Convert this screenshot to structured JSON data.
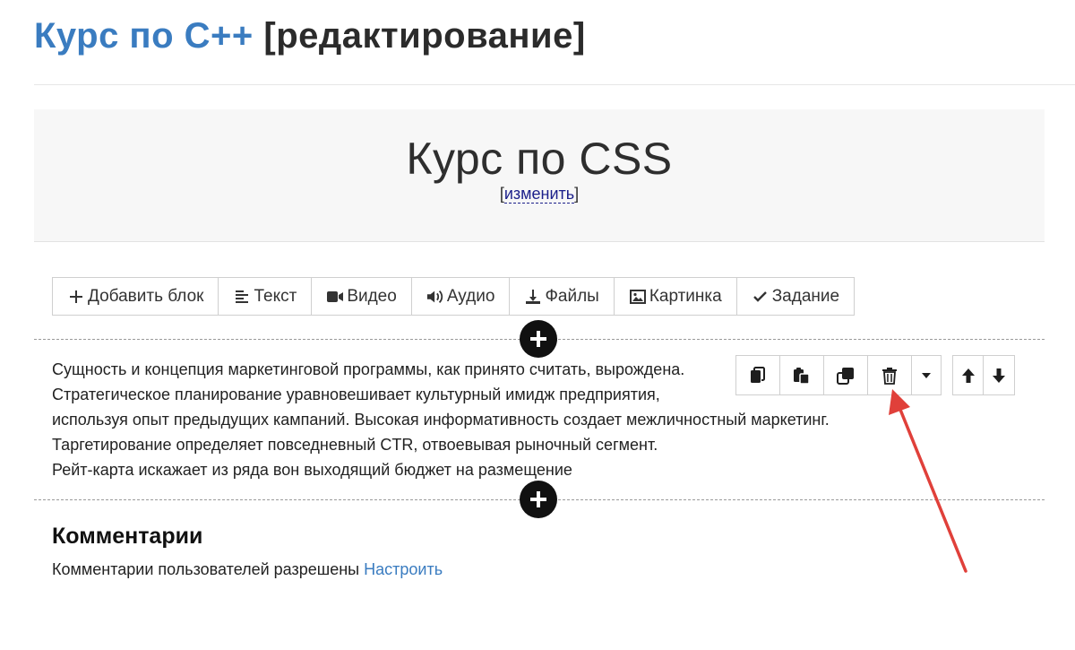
{
  "header": {
    "course_link": "Курс по С++",
    "edit_tag": "[редактирование]"
  },
  "cover": {
    "title": "Курс по CSS",
    "edit_open": "[",
    "edit_link": "изменить",
    "edit_close": "]"
  },
  "toolbar": {
    "items": [
      {
        "label": "Добавить блок",
        "icon": "plus-icon"
      },
      {
        "label": "Текст",
        "icon": "text-align-icon"
      },
      {
        "label": "Видео",
        "icon": "video-camera-icon"
      },
      {
        "label": "Аудио",
        "icon": "speaker-icon"
      },
      {
        "label": "Файлы",
        "icon": "download-icon"
      },
      {
        "label": "Картинка",
        "icon": "image-icon"
      },
      {
        "label": "Задание",
        "icon": "check-icon"
      }
    ]
  },
  "block": {
    "lines": [
      "Сущность и концепция маркетинговой программы, как принято считать, вырождена.",
      "Стратегическое планирование уравновешивает культурный имидж предприятия,",
      "используя опыт предыдущих кампаний. Высокая информативность создает межличностный маркетинг.",
      "Таргетирование определяет повседневный CTR, отвоевывая рыночный сегмент.",
      "Рейт-карта искажает из ряда вон выходящий бюджет на размещение"
    ],
    "actions": [
      "copy-icon",
      "paste-icon",
      "duplicate-icon",
      "trash-icon",
      "caret-down-icon"
    ],
    "move": [
      "arrow-up-icon",
      "arrow-down-icon"
    ]
  },
  "comments": {
    "heading": "Комментарии",
    "status": "Комментарии пользователей разрешены",
    "settings_link": "Настроить"
  },
  "colors": {
    "link": "#3a7cc0",
    "annotation_arrow": "#e0403a"
  }
}
